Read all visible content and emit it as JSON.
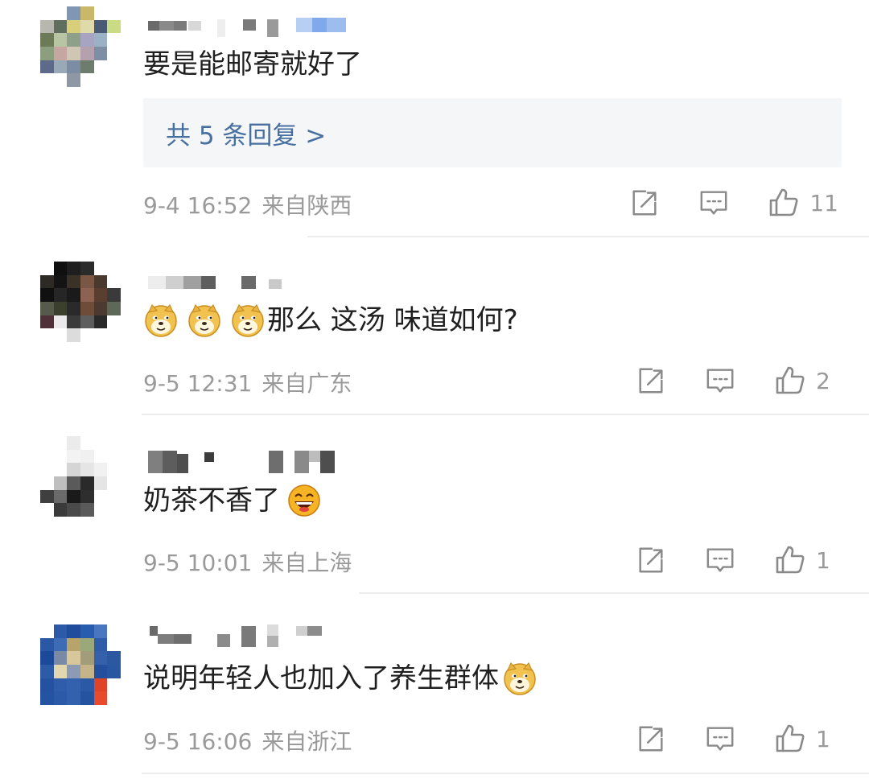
{
  "comments": [
    {
      "text": "要是能邮寄就好了",
      "emojis_before": 0,
      "emojis_after": [],
      "reply_link": "共 5 条回复 >",
      "date": "9-4 16:52",
      "location": "来自陕西",
      "likes": "11"
    },
    {
      "text": "那么 这汤 味道如何?",
      "emojis_before": 3,
      "emojis_after": [],
      "date": "9-5 12:31",
      "location": "来自广东",
      "likes": "2"
    },
    {
      "text": "奶茶不香了",
      "emojis_before": 0,
      "emojis_after": [
        "laughing-emoji"
      ],
      "date": "9-5 10:01",
      "location": "来自上海",
      "likes": "1"
    },
    {
      "text": "说明年轻人也加入了养生群体",
      "emojis_before": 0,
      "emojis_after": [
        "doge-emoji"
      ],
      "date": "9-5 16:06",
      "location": "来自浙江",
      "likes": "1"
    }
  ],
  "icons": {
    "share": "share-icon",
    "reply": "comment-icon",
    "like": "thumbs-up-icon",
    "doge": "doge-emoji",
    "laugh": "laughing-emoji"
  },
  "colors": {
    "link": "#476fa0",
    "meta": "#9a9a9a",
    "reply_bg": "#f5f6f8",
    "icon": "#8a8a8a"
  }
}
